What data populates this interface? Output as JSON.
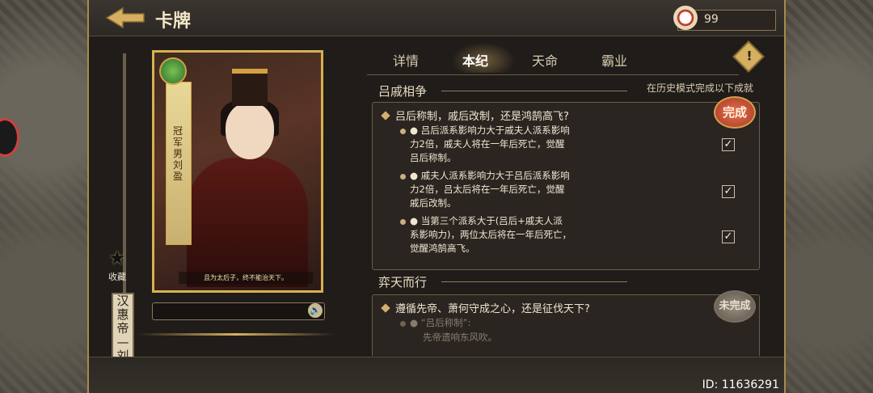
{
  "header": {
    "title": "卡牌",
    "currency_value": "99"
  },
  "footer": {
    "id_text": "ID: 11636291"
  },
  "card": {
    "hero_name": "汉惠帝—刘盈",
    "collect_label": "收藏",
    "sash_text": "冠军男刘盈",
    "quote": "且为太后子，终不能治天下。"
  },
  "tabs": [
    {
      "label": "详情",
      "active": false
    },
    {
      "label": "本纪",
      "active": true
    },
    {
      "label": "天命",
      "active": false
    },
    {
      "label": "霸业",
      "active": false
    }
  ],
  "sections": [
    {
      "title": "吕戚相争",
      "note": "在历史模式完成以下成就",
      "question": "吕后称制，戚后改制，还是鸿鹄高飞?",
      "status": "完成",
      "conditions": [
        {
          "text": "● 吕后派系影响力大于戚夫人派系影响力2倍，戚夫人将在一年后死亡，觉醒吕后称制。",
          "checked": true
        },
        {
          "text": "● 戚夫人派系影响力大于吕后派系影响力2倍，吕太后将在一年后死亡，觉醒戚后改制。",
          "checked": true
        },
        {
          "text": "● 当第三个派系大于(吕后+戚夫人派系影响力)，两位太后将在一年后死亡，觉醒鸿鹄高飞。",
          "checked": true
        }
      ]
    },
    {
      "title": "弈天而行",
      "question": "遵循先帝、萧何守成之心，还是征伐天下?",
      "status": "未完成",
      "conditions": [
        {
          "text": "● “吕后称制”:",
          "checked": false
        },
        {
          "text": "先帝遗响东风吹。",
          "checked": false
        }
      ]
    }
  ],
  "colors": {
    "accent_gold": "#d4b060",
    "done_seal": "#c04a30",
    "text": "#f0e6d0"
  }
}
